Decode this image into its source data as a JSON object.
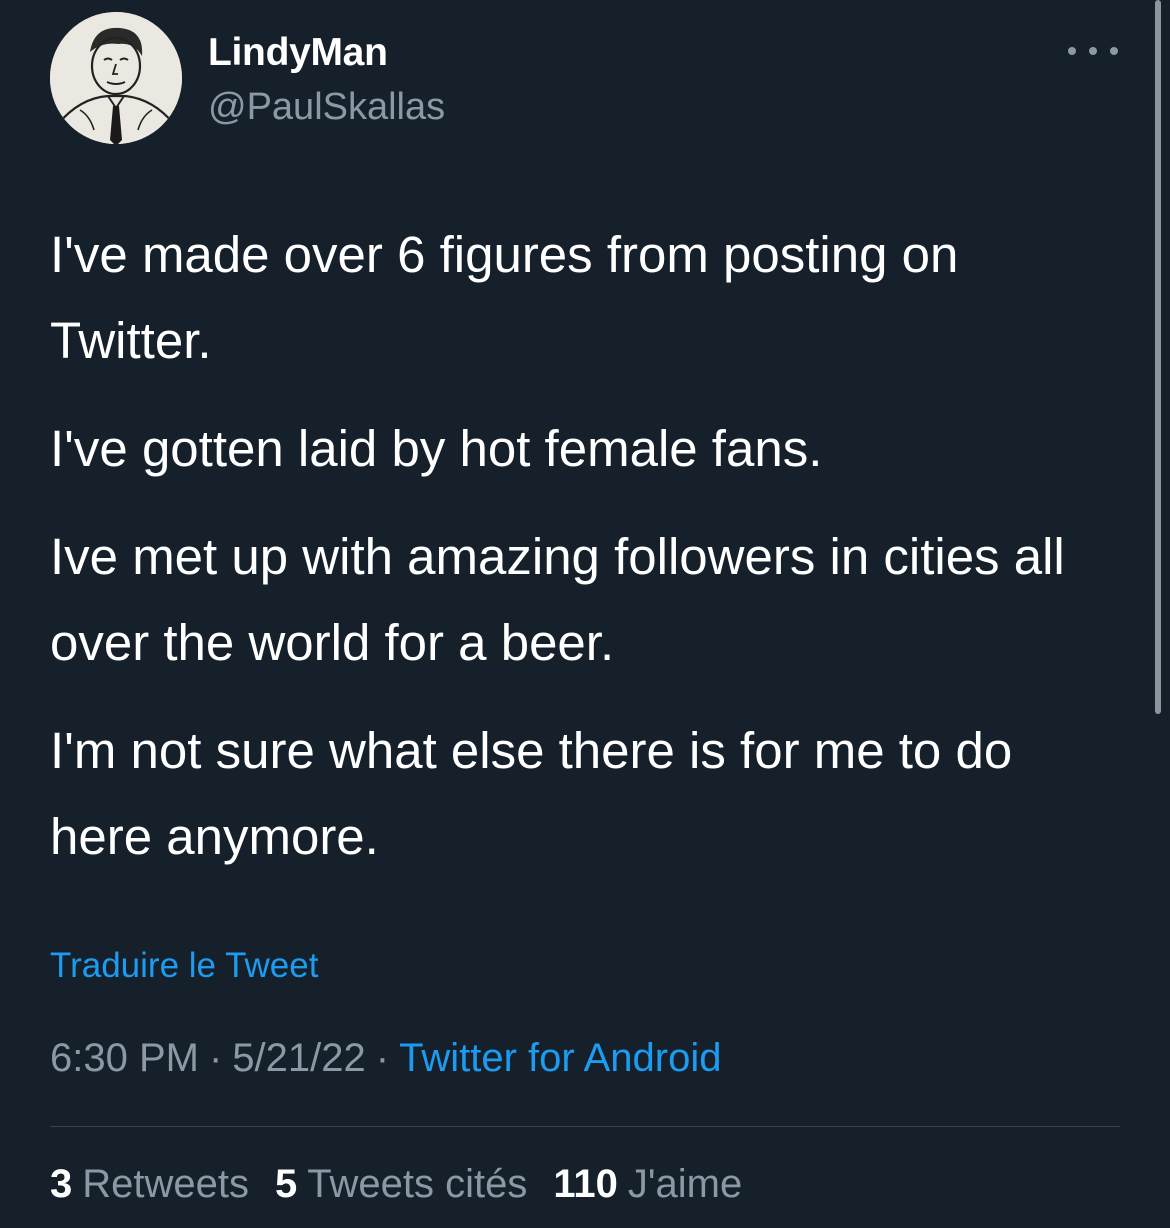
{
  "author": {
    "display_name": "LindyMan",
    "handle": "@PaulSkallas",
    "avatar_icon": "avatar-sketch-man-with-tie"
  },
  "more_icon": "more-horizontal-icon",
  "tweet": {
    "paragraphs": [
      "I've made over 6 figures from posting on Twitter.",
      "I've gotten laid by hot female fans.",
      "Ive met up with amazing followers in cities all over the world for a beer.",
      "I'm not sure what else there is for me to do here anymore."
    ],
    "translate_label": "Traduire le Tweet"
  },
  "meta": {
    "time": "6:30 PM",
    "date": "5/21/22",
    "separator": "·",
    "source": "Twitter for Android"
  },
  "stats": {
    "retweets_count": "3",
    "retweets_label": "Retweets",
    "quotes_count": "5",
    "quotes_label": "Tweets cités",
    "likes_count": "110",
    "likes_label": "J'aime"
  },
  "colors": {
    "background": "#15202b",
    "text": "#ffffff",
    "muted": "#8b98a5",
    "link": "#1d9bf0",
    "divider": "#38444d"
  }
}
